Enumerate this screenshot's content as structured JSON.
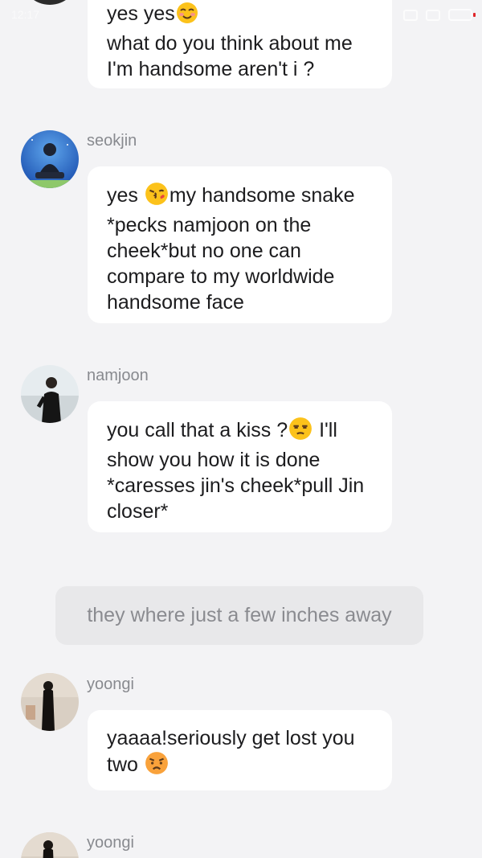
{
  "status_bar": {
    "time": "12:17"
  },
  "messages": [
    {
      "id": "m1",
      "sender": "",
      "avatar_icon": "avatar-partial-icon",
      "line1": "yes yes",
      "line1_emoji": "smiling-face-icon",
      "line2": "what do you think about me",
      "line3": "I'm handsome aren't i ?"
    },
    {
      "id": "m2",
      "sender": "seokjin",
      "avatar_icon": "seokjin-avatar-icon",
      "pre_emoji": "yes ",
      "emoji": "face-blowing-kiss-icon",
      "post_emoji": "my handsome snake *pecks namjoon on the cheek*but no one can compare to my worldwide handsome face"
    },
    {
      "id": "m3",
      "sender": "namjoon",
      "avatar_icon": "namjoon-avatar-icon",
      "pre_emoji": "you call that a kiss ?",
      "emoji": "unamused-face-icon",
      "post_emoji": " I'll show you how it is done *caresses jin's cheek*pull Jin closer*"
    },
    {
      "id": "m4",
      "sender": "yoongi",
      "avatar_icon": "yoongi-avatar-icon",
      "pre_emoji": "yaaaa!seriously get lost you two ",
      "emoji": "pouting-face-icon",
      "post_emoji": ""
    },
    {
      "id": "m5",
      "sender": "yoongi",
      "avatar_icon": "yoongi-avatar-icon"
    }
  ],
  "narration": {
    "text": "they where just a few inches away"
  },
  "colors": {
    "background": "#f3f3f5",
    "bubble": "#ffffff",
    "narration_bubble": "#e8e8ea",
    "sender_text": "#888a8f",
    "message_text": "#1c1c1e",
    "narration_text": "#8a8b90"
  }
}
